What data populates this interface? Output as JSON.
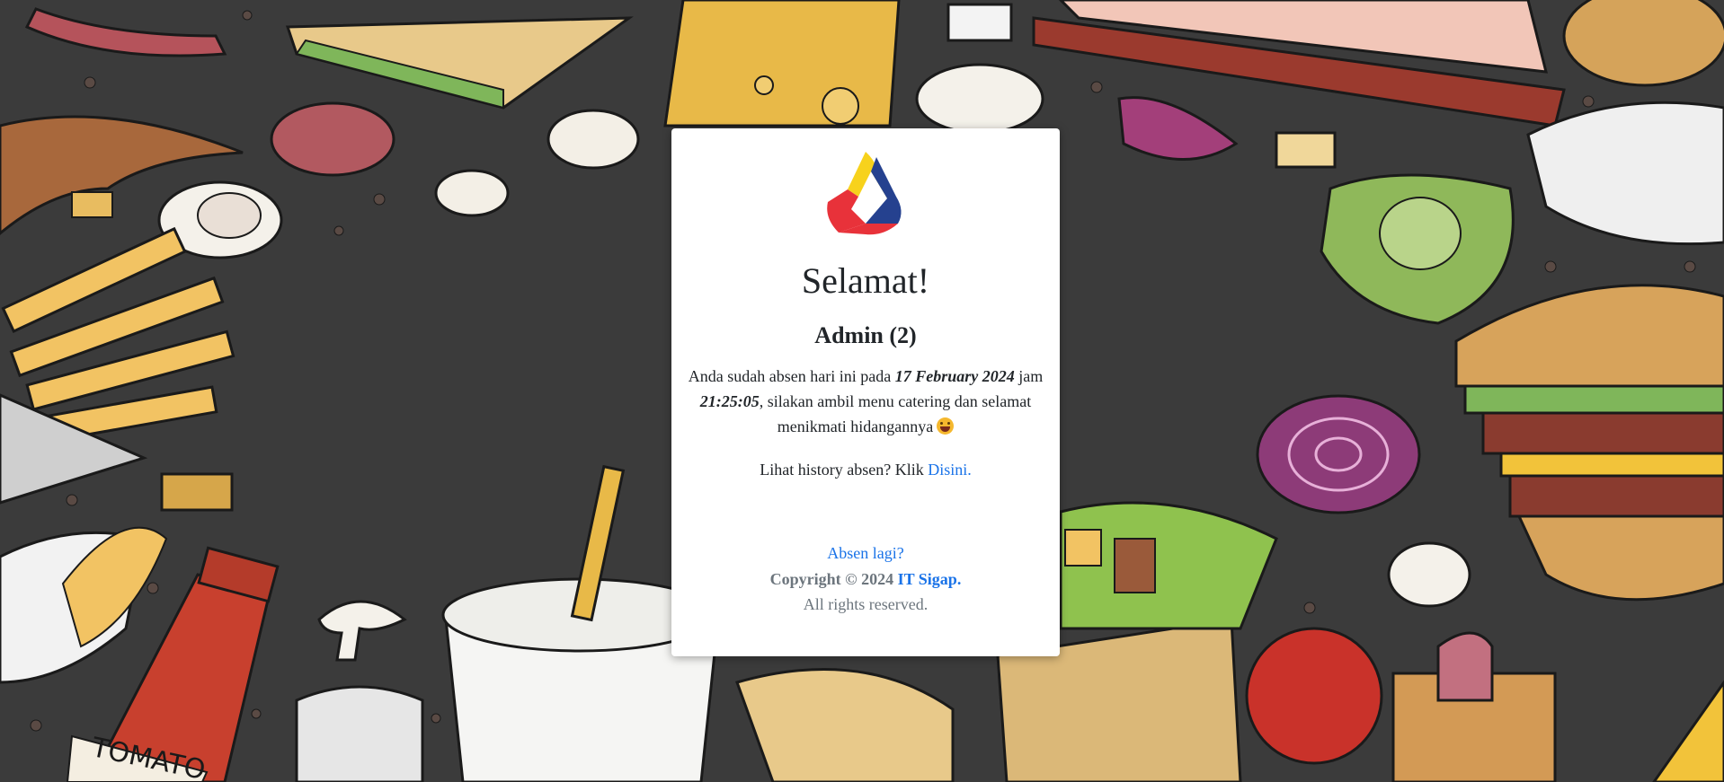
{
  "card": {
    "title": "Selamat!",
    "user": "Admin (2)",
    "message": {
      "part1": "Anda sudah absen hari ini pada ",
      "date": "17 February 2024",
      "part2": " jam ",
      "time": "21:25:05",
      "part3": ", silakan ambil menu catering dan selamat menikmati hidangannya"
    },
    "history": {
      "prefix": "Lihat history absen? Klik ",
      "link": "Disini."
    },
    "absen_again": "Absen lagi?",
    "copyright": {
      "prefix": "Copyright © 2024 ",
      "link": "IT Sigap."
    },
    "rights": "All rights reserved."
  },
  "icons": {
    "logo": "tricolor-triangle-logo",
    "emoji": "grinning-face-emoji"
  },
  "colors": {
    "link": "#1a73e8",
    "muted": "#6c757d",
    "logo_yellow": "#f7d21c",
    "logo_red": "#e8323a",
    "logo_blue": "#25418f"
  }
}
